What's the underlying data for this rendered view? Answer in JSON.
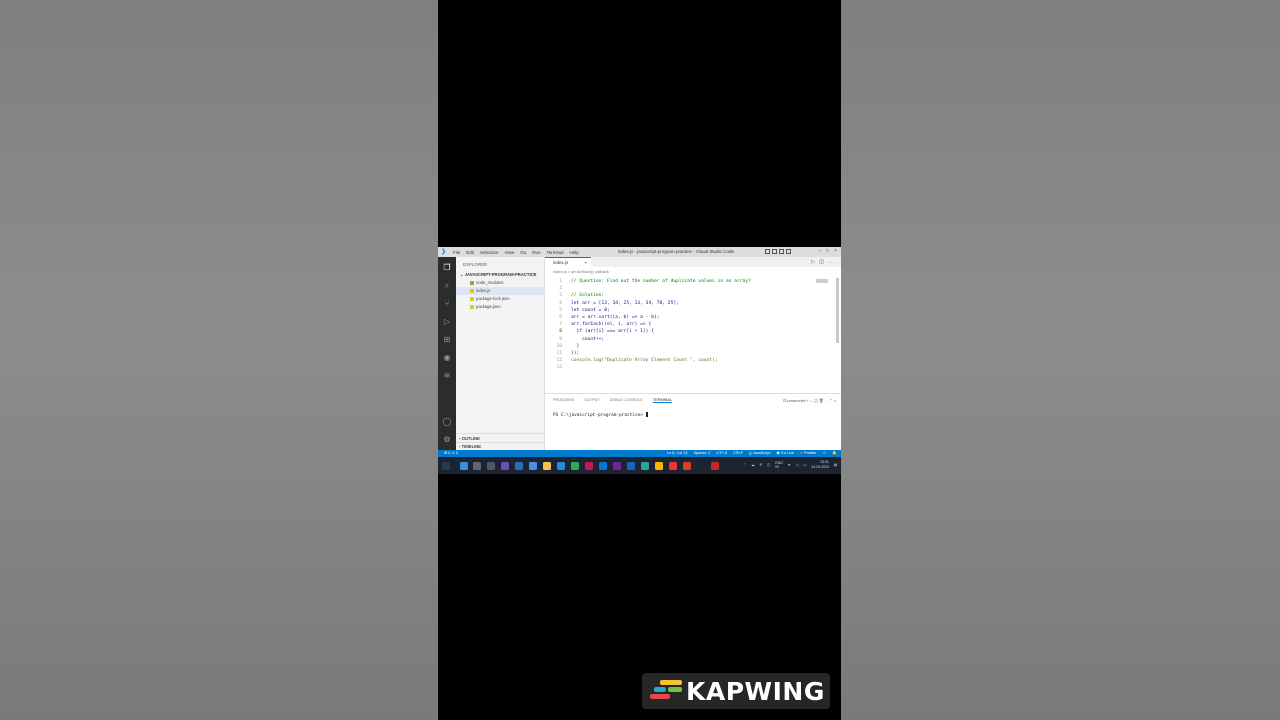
{
  "window": {
    "title": "index.js - javascript-program-practice - Visual Studio Code",
    "menu": [
      "File",
      "Edit",
      "Selection",
      "View",
      "Go",
      "Run",
      "Terminal",
      "Help"
    ]
  },
  "sidebar": {
    "header": "EXPLORER",
    "project": "JAVASCRIPT-PROGRAM-PRACTICE",
    "files": [
      "node_modules",
      "index.js",
      "package-lock.json",
      "package.json"
    ],
    "sections": [
      "OUTLINE",
      "TIMELINE"
    ]
  },
  "editor": {
    "tab": "index.js",
    "breadcrumb": "index.js > arr.forEach() callback",
    "lines": [
      {
        "n": "1",
        "text": "// Question: Find out the number of duplicate values in an array?"
      },
      {
        "n": "2",
        "text": ""
      },
      {
        "n": "3",
        "text": "// Solution:"
      },
      {
        "n": "4",
        "text": "let arr = [13, 34, 25, 13, 34, 78, 25];"
      },
      {
        "n": "5",
        "text": "let count = 0;"
      },
      {
        "n": "6",
        "text": "arr = arr.sort((a, b) => a - b);"
      },
      {
        "n": "7",
        "text": "arr.forEach((el, i, arr) => {"
      },
      {
        "n": "8",
        "text": "  if (arr[i] === arr[i + 1]) {"
      },
      {
        "n": "9",
        "text": "    count++;"
      },
      {
        "n": "10",
        "text": "  }"
      },
      {
        "n": "11",
        "text": "});"
      },
      {
        "n": "12",
        "text": "console.log(\"Duplicate Array Element Count \", count);"
      },
      {
        "n": "13",
        "text": ""
      }
    ]
  },
  "panel": {
    "tabs": [
      "PROBLEMS",
      "OUTPUT",
      "DEBUG CONSOLE",
      "TERMINAL"
    ],
    "shell": "powershell",
    "prompt": "PS C:\\javascript-program-practice> "
  },
  "status": {
    "left": "⊗ 0 ⚠ 0",
    "position": "Ln 8, Col 13",
    "spaces": "Spaces: 2",
    "encoding": "UTF-8",
    "eol": "CRLF",
    "language": "{} JavaScript",
    "golive": "Go Live",
    "prettier": "✓ Prettier"
  },
  "taskbar": {
    "lang": "ENG",
    "region": "IN",
    "time": "23:51",
    "date": "24-05-2023"
  },
  "watermark": "KAPWING",
  "colors": {
    "accent": "#007acc",
    "taskbar": "#1b2430",
    "activity_bar": "#2c2c2c"
  }
}
